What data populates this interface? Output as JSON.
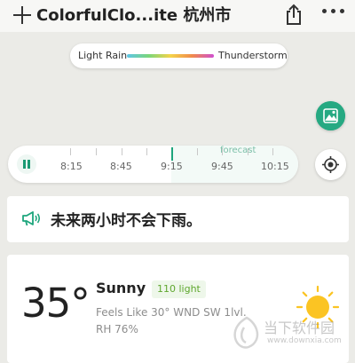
{
  "header": {
    "title": "ColorfulClo...ite  杭州市",
    "add_icon": "plus-icon",
    "share_icon": "share-icon",
    "more_icon": "more-dots-icon"
  },
  "map": {
    "legend": {
      "low_label": "Light Rain",
      "high_label": "Thunderstorm",
      "gradient_colors": [
        "#5ec6e8",
        "#7ad67a",
        "#f4d44a",
        "#f08a4b",
        "#d04fd0"
      ]
    },
    "layer_icon": "map-layers-icon",
    "locate_icon": "locate-icon",
    "timeline": {
      "play_icon": "pause-icon",
      "forecast_label": "forecast",
      "times": [
        "8:15",
        "8:45",
        "9:15",
        "9:45",
        "10:15"
      ]
    }
  },
  "alert": {
    "icon": "megaphone-icon",
    "text": "未来两小时不会下雨。"
  },
  "weather": {
    "temperature": "35°",
    "condition": "Sunny",
    "aqi": "110 light",
    "details_line1": "Feels Like 30°  WND SW 1lvl.",
    "details_line2": "RH 76%",
    "icon": "sun-icon"
  },
  "watermark": {
    "text_cn": "当下软件园",
    "url": "www.downxia.com"
  },
  "colors": {
    "accent": "#1da57c",
    "aqi": "#5fa72e",
    "sun": "#fbc423"
  }
}
